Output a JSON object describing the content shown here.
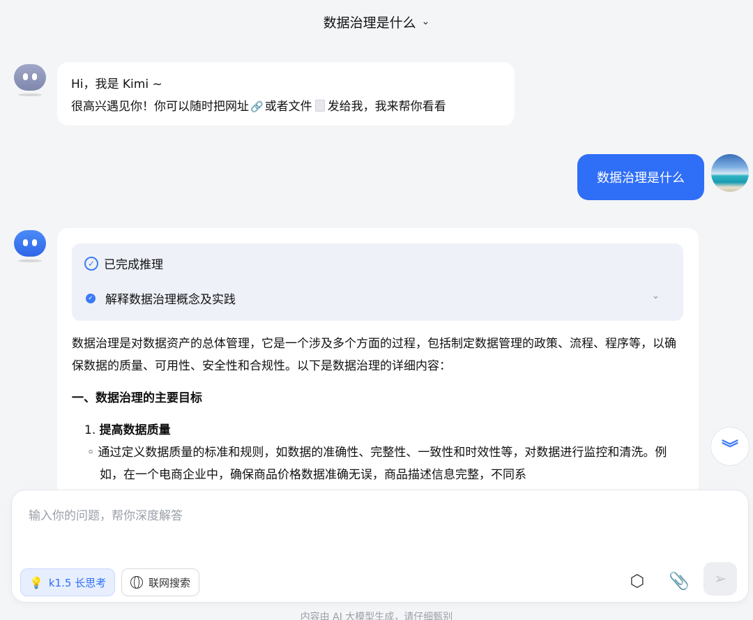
{
  "header": {
    "title": "数据治理是什么",
    "chevron_icon": "chevron-down-icon"
  },
  "messages": {
    "bot_greeting": {
      "line1": "Hi，我是 Kimi ~",
      "line2_a": "很高兴遇见你！你可以随时把网址",
      "line2_b": "或者文件",
      "line2_c": "发给我，我来帮你看看",
      "link_icon": "link-icon",
      "file_icon": "file-icon"
    },
    "user_question": "数据治理是什么",
    "bot_answer": {
      "reasoning_status": "已完成推理",
      "reasoning_step": "解释数据治理概念及实践",
      "intro": "数据治理是对数据资产的总体管理，它是一个涉及多个方面的过程，包括制定数据管理的政策、流程、程序等，以确保数据的质量、可用性、安全性和合规性。以下是数据治理的详细内容：",
      "section1_title": "一、数据治理的主要目标",
      "item1_number": "1.",
      "item1_title": "提高数据质量",
      "item1_bullet": "通过定义数据质量的标准和规则，如数据的准确性、完整性、一致性和时效性等，对数据进行监控和清洗。例如，在一个电商企业中，确保商品价格数据准确无误，商品描述信息完整，不同系"
    }
  },
  "composer": {
    "placeholder": "输入你的问题，帮你深度解答",
    "chip_k1": "k1.5 长思考",
    "chip_web": "联网搜索"
  },
  "disclaimer": "内容由 AI 大模型生成，请仔细甄别",
  "colors": {
    "accent": "#2f6ef6",
    "background": "#f4f5f7"
  }
}
